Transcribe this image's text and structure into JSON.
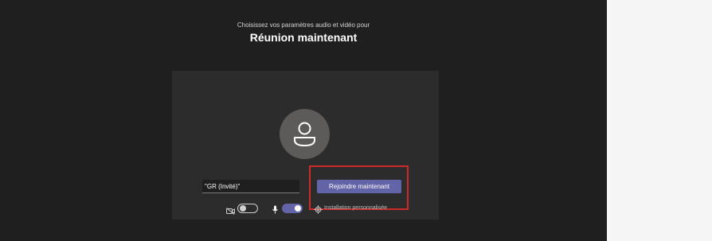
{
  "prejoin": {
    "subtitle": "Choisissez vos paramètres audio et vidéo pour",
    "meeting_title": "Réunion maintenant",
    "name_value": "\"GR (Invité)\"",
    "join_label": "Rejoindre maintenant",
    "custom_setup_label": "Installation personnalisée",
    "camera_on": false,
    "mic_on": true
  },
  "icons": {
    "avatar": "person-icon",
    "camera": "camera-off-icon",
    "mic": "microphone-icon",
    "settings": "gear-icon"
  },
  "colors": {
    "background": "#1f1f1f",
    "preview": "#2d2c2c",
    "accent": "#6264a7",
    "highlight": "#cc2b2b"
  }
}
